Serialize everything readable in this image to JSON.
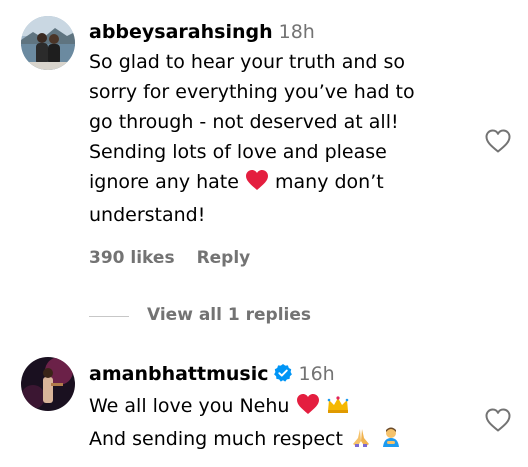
{
  "comments": [
    {
      "username": "abbeysarahsingh",
      "time": "18h",
      "verified": false,
      "lines": [
        "So glad to hear your truth and so",
        "sorry for everything you’ve had to",
        "go through - not deserved at all!",
        "Sending lots of love and please",
        "ignore any hate",
        "many don’t",
        "understand!"
      ],
      "likes": "390 likes",
      "reply_label": "Reply",
      "view_replies": "View all 1 replies",
      "avatar_icon": "avatar-photo-couple-lake",
      "like_icon": "heart-outline-icon"
    },
    {
      "username": "amanbhattmusic",
      "time": "16h",
      "verified": true,
      "lines": [
        "We all love you Nehu",
        "And sending much respect"
      ],
      "avatar_icon": "avatar-photo-stage",
      "like_icon": "heart-outline-icon"
    }
  ],
  "colors": {
    "text": "#000000",
    "secondary": "#737373",
    "verified": "#0095f6",
    "red_heart": "#e41e3f"
  }
}
